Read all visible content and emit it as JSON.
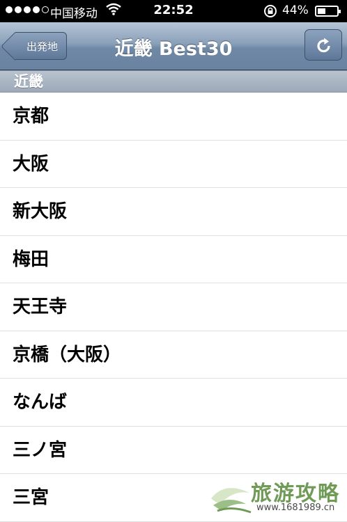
{
  "status_bar": {
    "carrier": "中国移动",
    "time": "22:52",
    "battery_percent": "44%",
    "battery_level": 0.44,
    "signal_bars_filled": 4,
    "icons": [
      "signal-dots-icon",
      "wifi-icon",
      "rotation-lock-icon",
      "battery-icon"
    ]
  },
  "nav": {
    "title": "近畿 Best30",
    "back_label": "出発地",
    "refresh_icon": "refresh-icon"
  },
  "section": {
    "header": "近畿"
  },
  "list": {
    "items": [
      "京都",
      "大阪",
      "新大阪",
      "梅田",
      "天王寺",
      "京橋（大阪）",
      "なんば",
      "三ノ宮",
      "三宮"
    ]
  },
  "watermark": {
    "text": "旅游攻略",
    "url": "www.1681989.cn"
  },
  "colors": {
    "nav_bar": "#7f96b2",
    "section_header": "#a9b5c3",
    "divider": "#e0e0e0"
  }
}
